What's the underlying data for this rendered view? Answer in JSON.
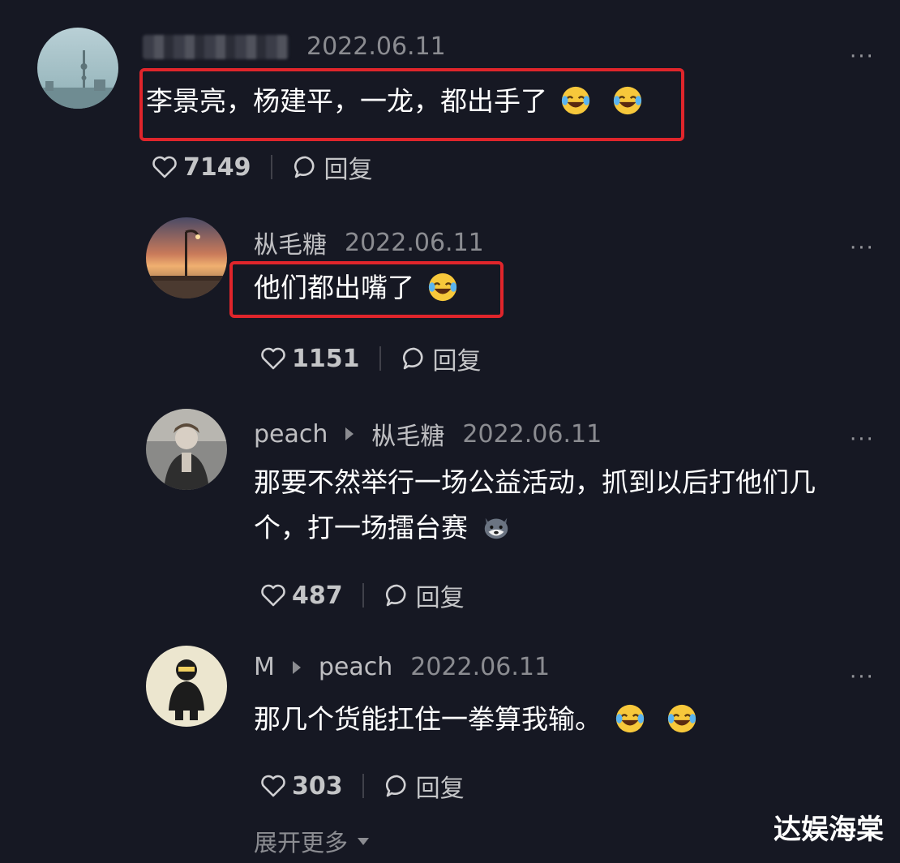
{
  "comments": [
    {
      "author": "",
      "date": "2022.06.11",
      "text": "李景亮，杨建平，一龙，都出手了",
      "emojis": [
        "laughing-tears-emoji",
        "laughing-tears-emoji"
      ],
      "likes": "7149",
      "reply_label": "回复",
      "more_label": "···"
    },
    {
      "author": "枞毛糖",
      "date": "2022.06.11",
      "text": "他们都出嘴了",
      "emojis": [
        "laughing-tears-emoji"
      ],
      "likes": "1151",
      "reply_label": "回复",
      "more_label": "···"
    },
    {
      "author": "peach",
      "reply_to": "枞毛糖",
      "date": "2022.06.11",
      "text_line1": "那要不然举行一场公益活动，抓到以后打他们几",
      "text_line2": "个，打一场擂台赛",
      "emojis": [
        "husky-dog-emoji"
      ],
      "likes": "487",
      "reply_label": "回复",
      "more_label": "···"
    },
    {
      "author": "M",
      "reply_to": "peach",
      "date": "2022.06.11",
      "text": "那几个货能扛住一拳算我输。",
      "emojis": [
        "laughing-tears-emoji",
        "laughing-tears-emoji"
      ],
      "likes": "303",
      "reply_label": "回复",
      "more_label": "···"
    }
  ],
  "expand_label": "展开更多",
  "watermark": "达娱海棠",
  "colors": {
    "background": "#161823",
    "highlight_border": "#e0252b",
    "text": "#ffffff"
  },
  "icons": [
    "heart-icon",
    "comment-bubble-icon",
    "more-dots-icon",
    "reply-arrow-icon",
    "expand-triangle-icon"
  ]
}
